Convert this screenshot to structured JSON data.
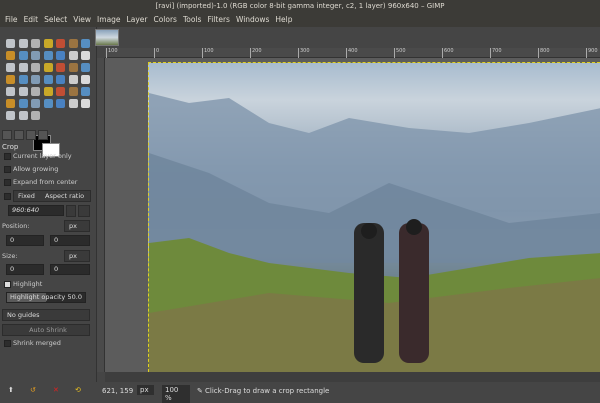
{
  "window": {
    "title": "[ravi] (imported)-1.0 (RGB color 8-bit gamma integer, c2, 1 layer) 960x640 – GIMP"
  },
  "menu": [
    "File",
    "Edit",
    "Select",
    "View",
    "Image",
    "Layer",
    "Colors",
    "Tools",
    "Filters",
    "Windows",
    "Help"
  ],
  "tool_options": {
    "title": "Crop",
    "current_layer_only": "Current layer only",
    "allow_growing": "Allow growing",
    "expand_from_center": "Expand from center",
    "fixed": "Fixed",
    "fixed_mode": "Aspect ratio",
    "ratio_value": "960:640",
    "position_label": "Position:",
    "position_unit": "px",
    "position_x": "0",
    "position_y": "0",
    "size_label": "Size:",
    "size_unit": "px",
    "size_w": "0",
    "size_h": "0",
    "highlight": "Highlight",
    "highlight_opacity_label": "Highlight opacity",
    "highlight_opacity": "50.0",
    "guides": "No guides",
    "auto_shrink": "Auto Shrink",
    "shrink_merged": "Shrink merged"
  },
  "ruler": [
    "100",
    "0",
    "100",
    "200",
    "300",
    "400",
    "500",
    "600",
    "700",
    "800",
    "900"
  ],
  "status": {
    "coords": "621, 159",
    "unit": "px",
    "zoom": "100 %",
    "hint": "Click-Drag to draw a crop rectangle"
  },
  "colors": {
    "fg": "#000000",
    "bg": "#ffffff",
    "selection": "#e0d020"
  }
}
